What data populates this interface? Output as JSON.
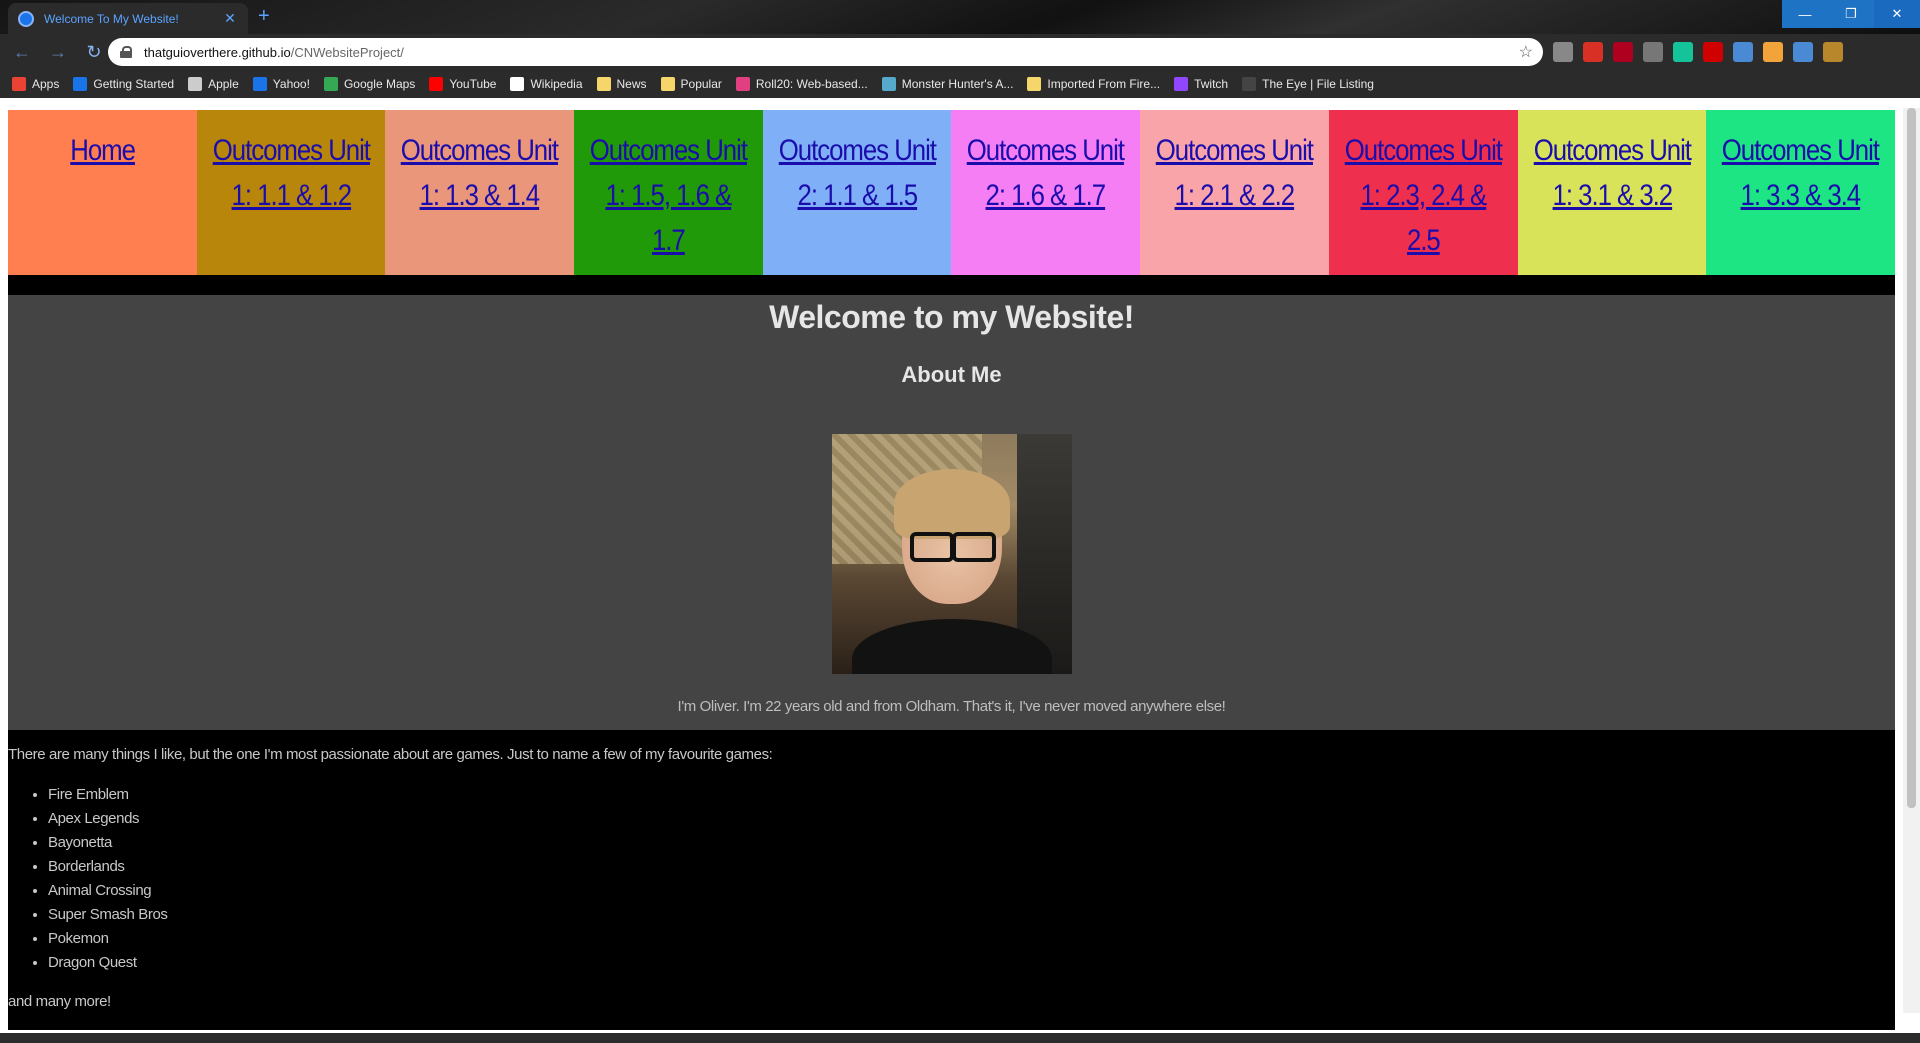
{
  "browser": {
    "tab_title": "Welcome To My Website!",
    "url_host": "thatguioverthere.github.io",
    "url_path": "/CNWebsiteProject/",
    "bookmarks": [
      {
        "label": "Apps",
        "color": "#ea4335"
      },
      {
        "label": "Getting Started",
        "color": "#1a73e8"
      },
      {
        "label": "Apple",
        "color": "#cccccc"
      },
      {
        "label": "Yahoo!",
        "color": "#1a73e8"
      },
      {
        "label": "Google Maps",
        "color": "#34a853"
      },
      {
        "label": "YouTube",
        "color": "#ff0000"
      },
      {
        "label": "Wikipedia",
        "color": "#ffffff"
      },
      {
        "label": "News",
        "color": "#f6d66b"
      },
      {
        "label": "Popular",
        "color": "#f6d66b"
      },
      {
        "label": "Roll20: Web-based...",
        "color": "#e0407f"
      },
      {
        "label": "Monster Hunter's A...",
        "color": "#55aacc"
      },
      {
        "label": "Imported From Fire...",
        "color": "#f6d66b"
      },
      {
        "label": "Twitch",
        "color": "#9146ff"
      },
      {
        "label": "The Eye | File Listing",
        "color": "#444444"
      }
    ],
    "extension_colors": [
      "#888888",
      "#d93025",
      "#b00020",
      "#777777",
      "#15c39a",
      "#d00000",
      "#4a8ad4",
      "#f2a33a",
      "#4a8ad4",
      "#b8872c"
    ]
  },
  "nav": [
    {
      "label": "Home",
      "color": "#ff7f50"
    },
    {
      "label": "Outcomes Unit 1: 1.1 & 1.2",
      "color": "#b8860b"
    },
    {
      "label": "Outcomes Unit 1: 1.3 & 1.4",
      "color": "#e9967a"
    },
    {
      "label": "Outcomes Unit 1: 1.5, 1.6 & 1.7",
      "color": "#209a08"
    },
    {
      "label": "Outcomes Unit 2: 1.1 & 1.5",
      "color": "#7fb0f7"
    },
    {
      "label": "Outcomes Unit 2: 1.6 & 1.7",
      "color": "#f57ef5"
    },
    {
      "label": "Outcomes Unit 1: 2.1 & 2.2",
      "color": "#f8a4a8"
    },
    {
      "label": "Outcomes Unit 1: 2.3, 2.4 & 2.5",
      "color": "#ef2f4e"
    },
    {
      "label": "Outcomes Unit 1: 3.1 & 3.2",
      "color": "#d9e35a"
    },
    {
      "label": "Outcomes Unit 1: 3.3 & 3.4",
      "color": "#1ee583"
    }
  ],
  "about": {
    "heading": "Welcome to my Website!",
    "subheading": "About Me",
    "caption": "I'm Oliver. I'm 22 years old and from Oldham. That's it, I've never moved anywhere else!"
  },
  "games": {
    "intro": "There are many things I like, but the one I'm most passionate about are games. Just to name a few of my favourite games:",
    "list": [
      "Fire Emblem",
      "Apex Legends",
      "Bayonetta",
      "Borderlands",
      "Animal Crossing",
      "Super Smash Bros",
      "Pokemon",
      "Dragon Quest"
    ],
    "outro": "and many more!"
  }
}
